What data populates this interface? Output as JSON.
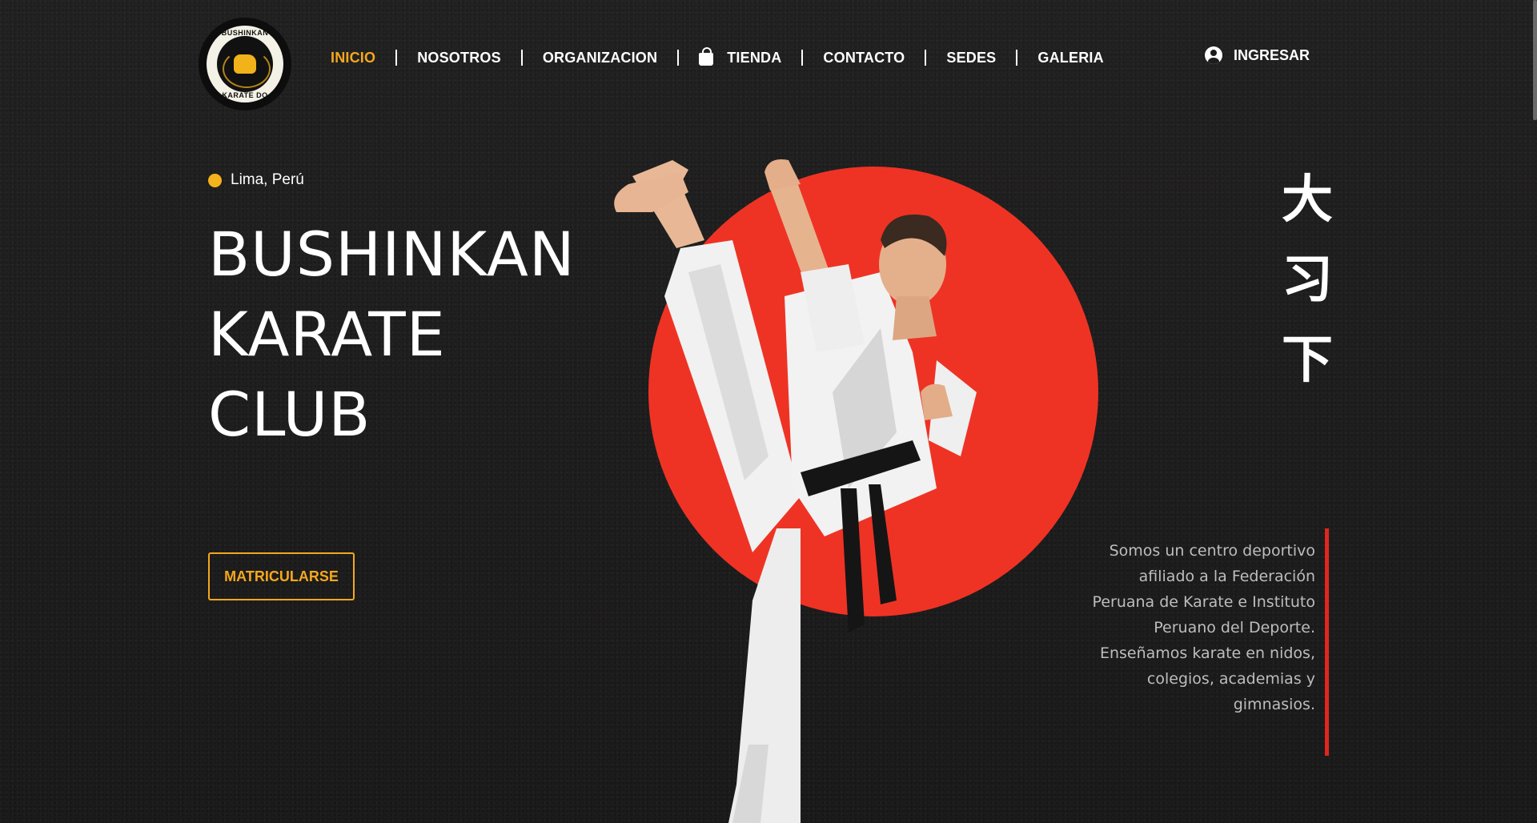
{
  "header": {
    "logo": {
      "top_text": "BUSHINKAN",
      "bottom_text": "KARATE DO"
    },
    "nav": [
      {
        "label": "INICIO",
        "active": true
      },
      {
        "label": "NOSOTROS"
      },
      {
        "label": "ORGANIZACION"
      },
      {
        "label": "TIENDA",
        "icon": "shopping-bag-icon"
      },
      {
        "label": "CONTACTO"
      },
      {
        "label": "SEDES"
      },
      {
        "label": "GALERIA"
      }
    ],
    "login": {
      "label": "INGRESAR",
      "icon": "user-icon"
    }
  },
  "hero": {
    "location": "Lima, Perú",
    "title_lines": [
      "BUSHINKAN",
      "KARATE",
      "CLUB"
    ],
    "cta_label": "MATRICULARSE",
    "kanji": [
      "大",
      "习",
      "下"
    ],
    "description": "Somos un centro deportivo afiliado a la Federación Peruana de Karate e Instituto Peruano del Deporte. Enseñamos karate en nidos, colegios, academias y gimnasios."
  },
  "colors": {
    "accent": "#f4a81d",
    "sun": "#ee3325",
    "rule": "#e0261f",
    "background": "#1e1d1d"
  }
}
